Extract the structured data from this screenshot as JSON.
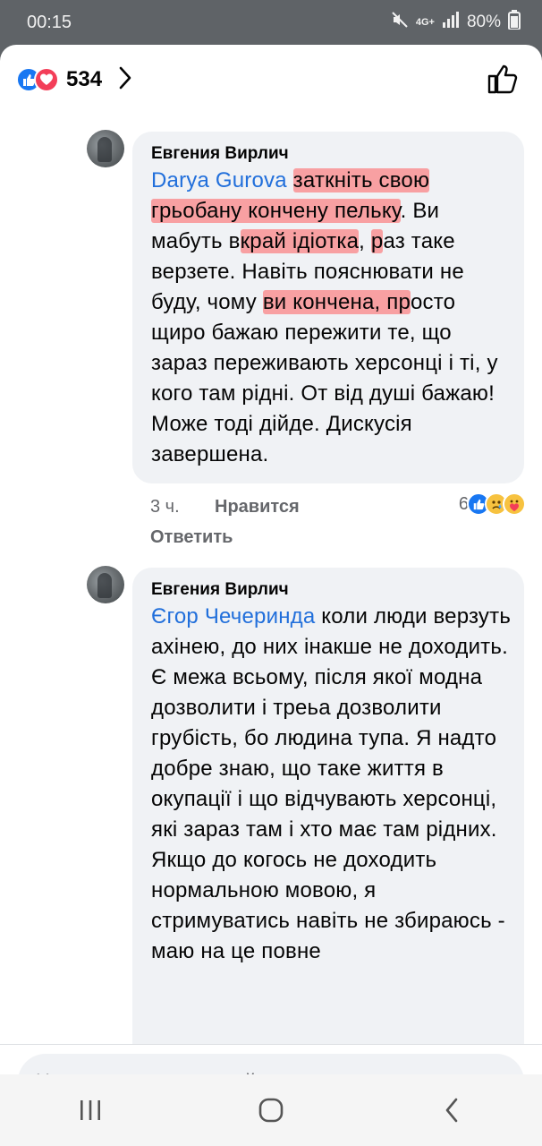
{
  "status": {
    "time": "00:15",
    "network": "4G+",
    "battery": "80%"
  },
  "reactions": {
    "count": "534"
  },
  "comments": [
    {
      "author": "Евгения Вирлич",
      "mention": "Darya Gurova",
      "segments": [
        " ",
        "заткніть свою",
        " ",
        "грьобану кончену пельку",
        ". Ви мабуть в",
        "край ідіотка",
        ", ",
        "р",
        "аз таке верзете. Навіть пояснювати не буду, чому ",
        "ви кончена, пр",
        "осто щиро бажаю пережити те, що зараз переживають херсонці і ті, у кого там рідні. От від душі бажаю! Може тоді дійде. Дискусія завершена."
      ],
      "time": "3 ч.",
      "like_label": "Нравится",
      "reply_label": "Ответить",
      "reaction_count": "6"
    },
    {
      "author": "Евгения Вирлич",
      "mention": "Єгор Чечеринда",
      "text": " коли люди верзуть ахінею, до них інакше не доходить. Є межа всьому, після якої модна дозволити і треьа дозволити грубість, бо людина тупа. Я надто добре знаю, що таке життя в окупації і що відчувають херсонці, які зараз там і хто має там рідних. Якщо до когось не доходить нормальною мовою, я стримуватись навіть не збираюсь - маю на це повне"
    }
  ],
  "composer": {
    "placeholder": "Напишите комментарий…"
  },
  "icons": {
    "like": "like-reaction-icon",
    "love": "love-reaction-icon",
    "sad": "sad-reaction-icon",
    "care": "care-reaction-icon",
    "thumb": "thumbs-up-icon",
    "chevron": "chevron-right-icon"
  },
  "colors": {
    "accent": "#1877f2",
    "mention": "#216fdb",
    "highlight": "#ff5c5c"
  }
}
